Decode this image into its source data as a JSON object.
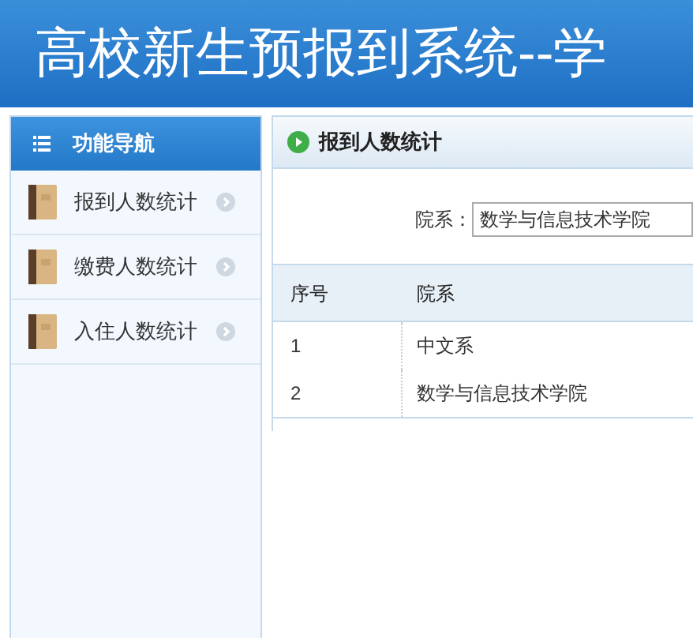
{
  "header": {
    "title": "高校新生预报到系统--学"
  },
  "sidebar": {
    "title": "功能导航",
    "items": [
      {
        "label": "报到人数统计"
      },
      {
        "label": "缴费人数统计"
      },
      {
        "label": "入住人数统计"
      }
    ]
  },
  "panel": {
    "title": "报到人数统计",
    "filter": {
      "label": "院系：",
      "value": "数学与信息技术学院"
    },
    "table": {
      "columns": [
        "序号",
        "院系"
      ],
      "rows": [
        [
          "1",
          "中文系"
        ],
        [
          "2",
          "数学与信息技术学院"
        ]
      ]
    }
  }
}
